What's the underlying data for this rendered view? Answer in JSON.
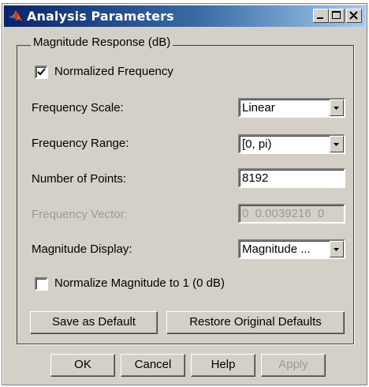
{
  "window": {
    "title": "Analysis Parameters",
    "minimize_icon": "minimize-icon",
    "maximize_icon": "maximize-icon",
    "close_icon": "close-icon",
    "app_icon": "matlab-logo-icon"
  },
  "panel": {
    "title": "Magnitude Response (dB)",
    "normalized_frequency": {
      "label": "Normalized Frequency",
      "checked": true
    },
    "frequency_scale": {
      "label": "Frequency Scale:",
      "value": "Linear"
    },
    "frequency_range": {
      "label": "Frequency Range:",
      "value": "[0, pi)"
    },
    "number_of_points": {
      "label": "Number of Points:",
      "value": "8192"
    },
    "frequency_vector": {
      "label": "Frequency Vector:",
      "value": "0  0.0039216  0",
      "enabled": false
    },
    "magnitude_display": {
      "label": "Magnitude Display:",
      "value": "Magnitude ..."
    },
    "normalize_magnitude": {
      "label": "Normalize Magnitude to 1 (0 dB)",
      "checked": false
    },
    "save_default_label": "Save as Default",
    "restore_defaults_label": "Restore Original Defaults"
  },
  "footer": {
    "ok_label": "OK",
    "cancel_label": "Cancel",
    "help_label": "Help",
    "apply_label": "Apply"
  },
  "colors": {
    "dialog_bg": "#d4d0c8",
    "titlebar_start": "#0a246a",
    "titlebar_end": "#a6caf0",
    "disabled_text": "#9c9a94"
  }
}
